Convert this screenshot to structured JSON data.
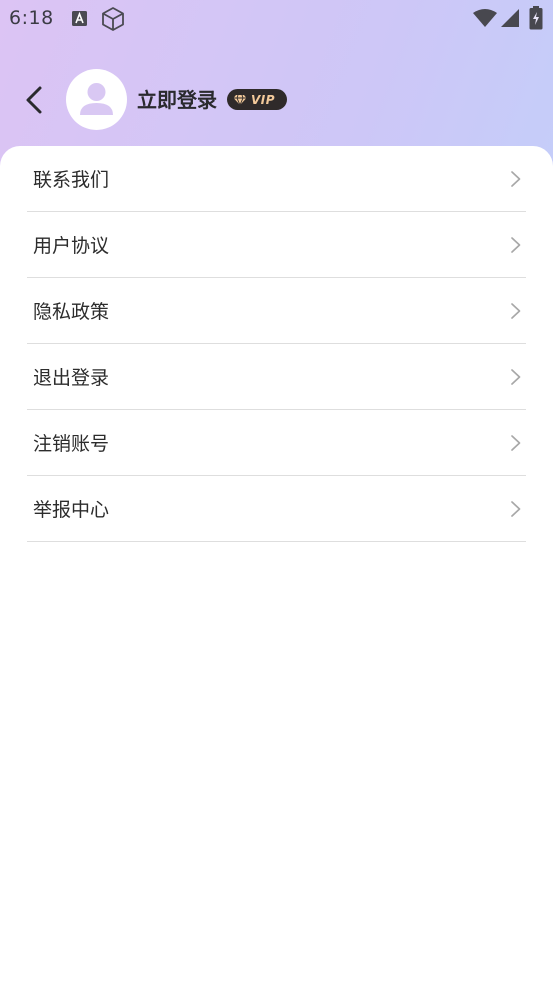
{
  "status_bar": {
    "time": "6:18",
    "icons": [
      "font-a-icon",
      "cube-icon",
      "wifi-icon",
      "signal-icon",
      "battery-charging-icon"
    ]
  },
  "header": {
    "back_icon": "chevron-left-icon",
    "avatar_icon": "user-avatar-icon",
    "login_label": "立即登录",
    "vip_label": "VIP",
    "vip_icon": "diamond-icon"
  },
  "menu": {
    "items": [
      {
        "label": "联系我们",
        "icon": "chevron-right-icon"
      },
      {
        "label": "用户协议",
        "icon": "chevron-right-icon"
      },
      {
        "label": "隐私政策",
        "icon": "chevron-right-icon"
      },
      {
        "label": "退出登录",
        "icon": "chevron-right-icon"
      },
      {
        "label": "注销账号",
        "icon": "chevron-right-icon"
      },
      {
        "label": "举报中心",
        "icon": "chevron-right-icon"
      }
    ]
  },
  "colors": {
    "gradient_start": "#dcc4f4",
    "gradient_end": "#b9d6fd",
    "avatar_icon": "#d9c8f3",
    "vip_badge_bg": "#2f2a2a",
    "vip_text": "#f3c99a",
    "divider": "#dedede"
  }
}
